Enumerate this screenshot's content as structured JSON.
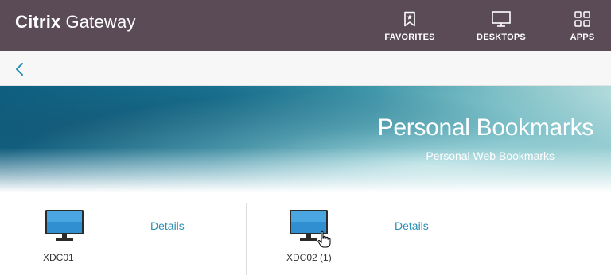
{
  "header": {
    "brand_bold": "Citrix",
    "brand_light": "Gateway",
    "nav": [
      {
        "label": "FAVORITES",
        "icon": "bookmark-star-icon"
      },
      {
        "label": "DESKTOPS",
        "icon": "monitor-icon"
      },
      {
        "label": "APPS",
        "icon": "grid-icon"
      }
    ],
    "background_color": "#5a4b57"
  },
  "subbar": {
    "back_icon": "chevron-left-icon",
    "accent_color": "#2a8fb4"
  },
  "banner": {
    "title": "Personal Bookmarks",
    "subtitle": "Personal Web Bookmarks"
  },
  "resources": [
    {
      "name": "XDC01",
      "details_label": "Details",
      "icon": "desktop-monitor-icon"
    },
    {
      "name": "XDC02 (1)",
      "details_label": "Details",
      "icon": "desktop-monitor-icon"
    }
  ]
}
